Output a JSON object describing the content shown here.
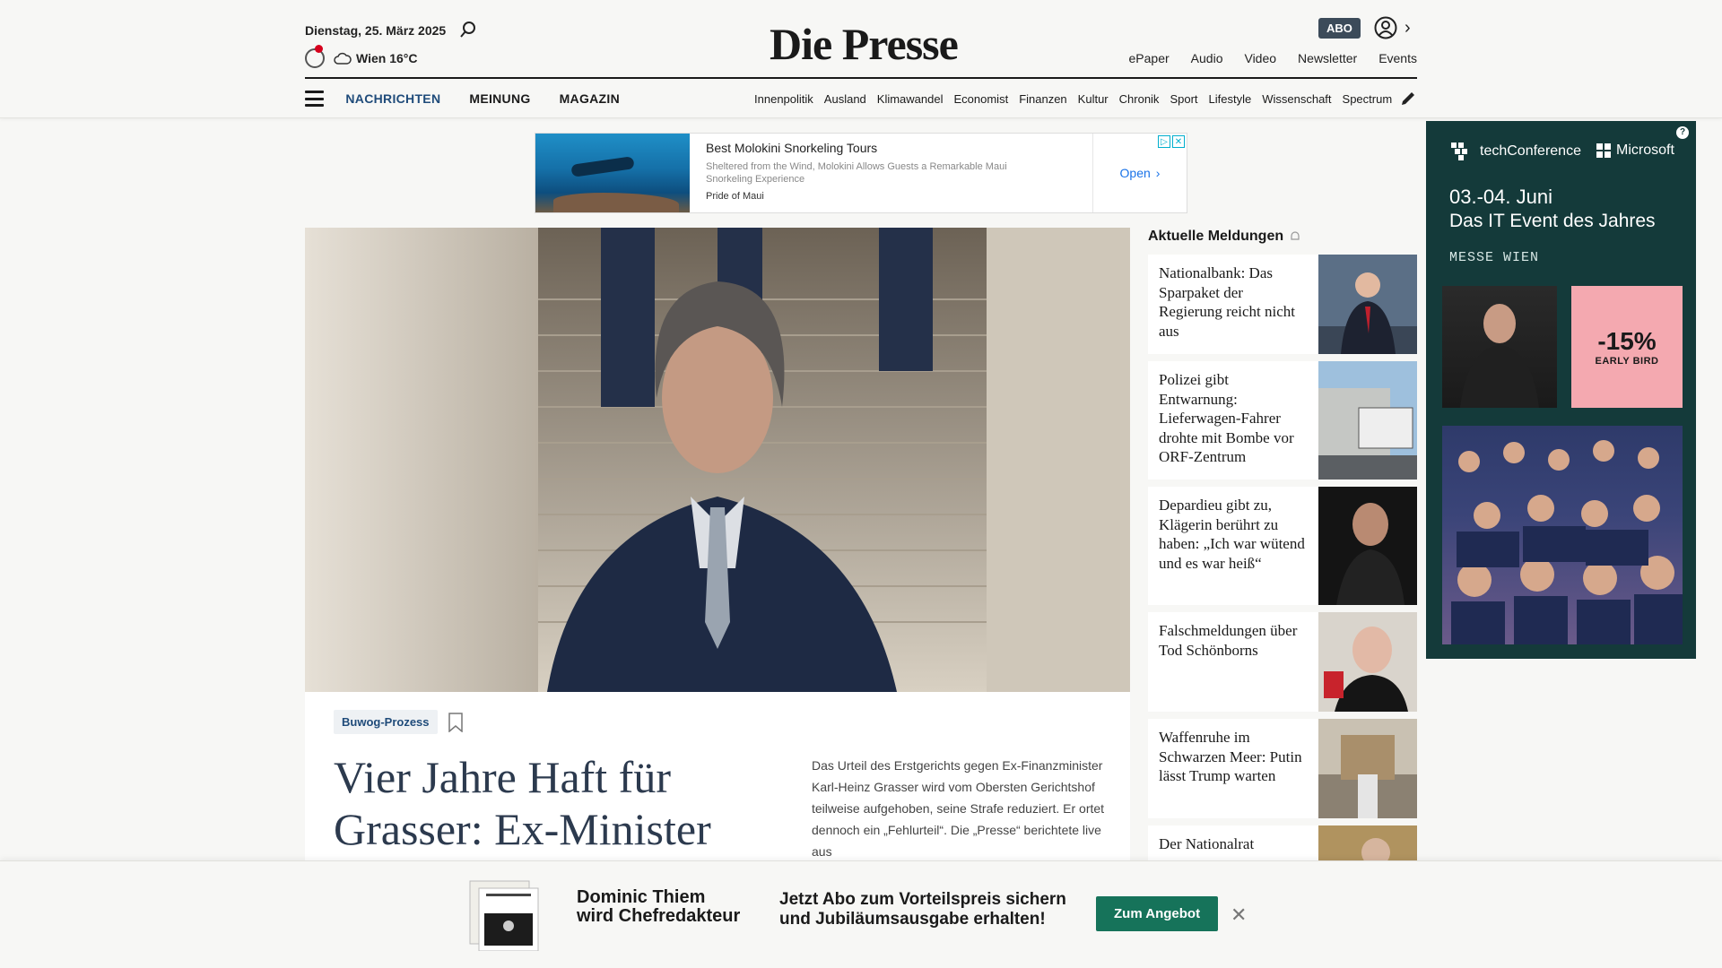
{
  "header": {
    "date": "Dienstag, 25. März 2025",
    "weather": "Wien 16°C",
    "logo": "Die Presse",
    "abo": "ABO",
    "links": [
      "ePaper",
      "Audio",
      "Video",
      "Newsletter",
      "Events"
    ]
  },
  "nav": {
    "main": [
      "NACHRICHTEN",
      "MEINUNG",
      "MAGAZIN"
    ],
    "sub": [
      "Innenpolitik",
      "Ausland",
      "Klimawandel",
      "Economist",
      "Finanzen",
      "Kultur",
      "Chronik",
      "Sport",
      "Lifestyle",
      "Wissenschaft",
      "Spectrum"
    ]
  },
  "ad": {
    "title": "Best Molokini Snorkeling Tours",
    "description": "Sheltered from the Wind, Molokini Allows Guests a Remarkable Maui Snorkeling Experience",
    "source": "Pride of Maui",
    "cta": "Open"
  },
  "hero": {
    "tag": "Buwog-Prozess",
    "headline": "Vier Jahre Haft für Grasser: Ex-Minister",
    "teaser": "Das Urteil des Erstgerichts gegen Ex-Finanzminister Karl-Heinz Grasser wird vom Obersten Gerichtshof teilweise aufgehoben, seine Strafe reduziert. Er ortet dennoch ein „Fehlurteil“. Die „Presse“ berichtete live aus"
  },
  "sidebar": {
    "title": "Aktuelle Meldungen",
    "items": [
      {
        "text": "Nationalbank: Das Sparpaket der Regierung reicht nicht aus"
      },
      {
        "text": "Polizei gibt Entwarnung: Lieferwagen-Fahrer drohte mit Bombe vor ORF-Zentrum"
      },
      {
        "text": "Depardieu gibt zu, Klägerin berührt zu haben: „Ich war wütend und es war heiß“"
      },
      {
        "text": "Falschmeldungen über Tod Schönborns"
      },
      {
        "text": "Waffenruhe im Schwarzen Meer: Putin lässt Trump warten"
      },
      {
        "text": "Der Nationalrat"
      }
    ]
  },
  "right_ad": {
    "brand": "techConference",
    "partner": "Microsoft",
    "date": "03.-04. Juni",
    "subtitle": "Das IT Event des Jahres",
    "location": "MESSE WIEN",
    "discount": "-15%",
    "discount_label": "EARLY BIRD"
  },
  "promo": {
    "name_line1": "Dominic Thiem",
    "name_line2": "wird Chefredakteur",
    "text_line1": "Jetzt Abo zum Vorteilspreis sichern",
    "text_line2": "und Jubiläumsausgabe erhalten!",
    "button": "Zum Angebot"
  }
}
